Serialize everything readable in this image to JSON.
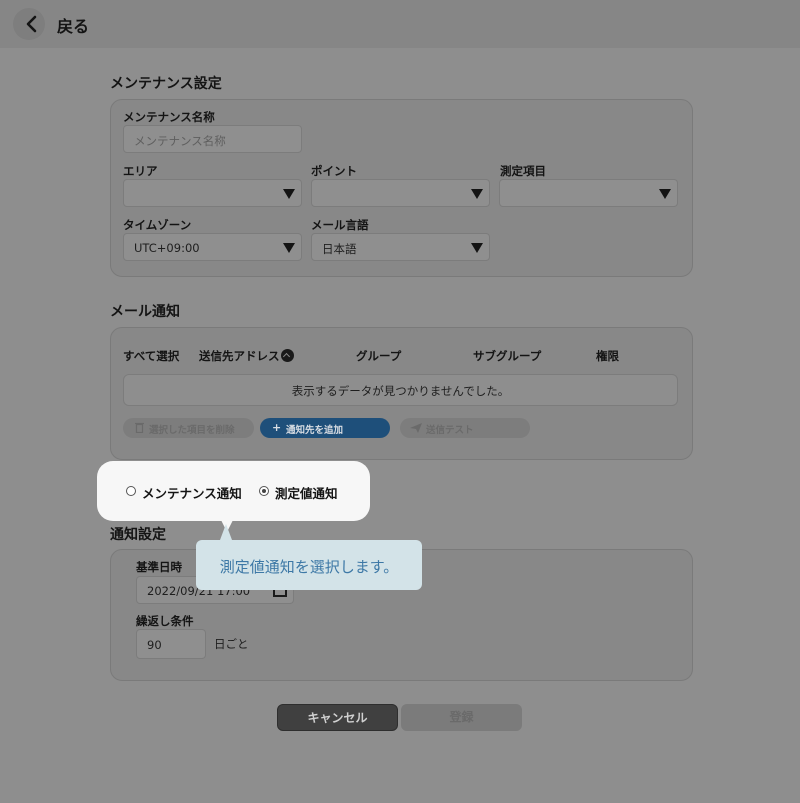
{
  "header": {
    "back_label": "戻る"
  },
  "maintenance": {
    "section_title": "メンテナンス設定",
    "name": {
      "label": "メンテナンス名称",
      "placeholder": "メンテナンス名称",
      "value": ""
    },
    "area": {
      "label": "エリア",
      "value": ""
    },
    "point": {
      "label": "ポイント",
      "value": ""
    },
    "measurement_item": {
      "label": "測定項目",
      "value": ""
    },
    "timezone": {
      "label": "タイムゾーン",
      "value": "UTC+09:00"
    },
    "mail_language": {
      "label": "メール言語",
      "value": "日本語"
    }
  },
  "mail": {
    "section_title": "メール通知",
    "columns": [
      "すべて選択",
      "送信先アドレス",
      "グループ",
      "サブグループ",
      "権限"
    ],
    "empty_message": "表示するデータが見つかりませんでした。",
    "actions": {
      "delete_selected": "選択した項目を削除",
      "add_recipient": "通知先を追加",
      "send_test": "送信テスト"
    }
  },
  "notification_type": {
    "options": [
      "メンテナンス通知",
      "測定値通知"
    ],
    "selected": "測定値通知"
  },
  "notification_settings": {
    "section_title": "通知設定",
    "base_datetime": {
      "label": "基準日時",
      "value": "2022/09/21 17:00"
    },
    "repeat": {
      "label": "繰返し条件",
      "value": "90",
      "unit": "日ごと"
    }
  },
  "tooltip": {
    "text": "測定値通知を選択します。"
  },
  "footer": {
    "cancel_label": "キャンセル",
    "register_label": "登録"
  }
}
